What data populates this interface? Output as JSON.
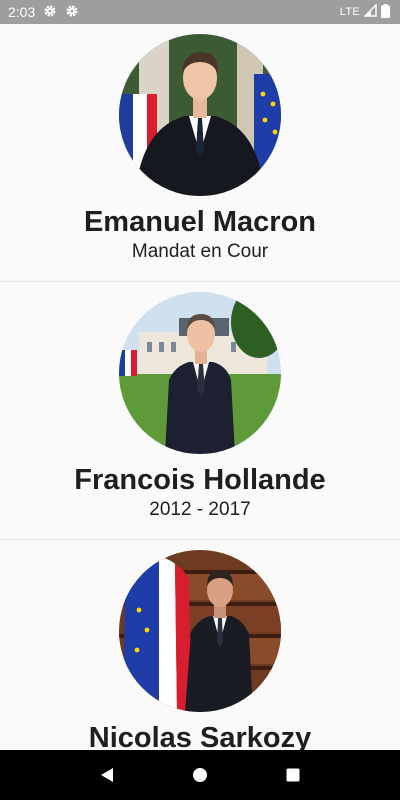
{
  "status_bar": {
    "time": "2:03",
    "left_icons": [
      "gear-icon",
      "gear-icon"
    ],
    "network": "LTE",
    "right_icons": [
      "signal-icon",
      "battery-icon"
    ]
  },
  "presidents": [
    {
      "name": "Emanuel Macron",
      "subtitle": "Mandat en Cour"
    },
    {
      "name": "Francois Hollande",
      "subtitle": "2012 - 2017"
    },
    {
      "name": "Nicolas Sarkozy",
      "subtitle": ""
    }
  ],
  "nav_bar": {
    "buttons": [
      "back-icon",
      "home-icon",
      "recents-icon"
    ]
  },
  "colors": {
    "status_bar": "#9e9e9e",
    "background": "#fafafa",
    "text": "#1f1f1f",
    "nav_bar": "#000000"
  }
}
